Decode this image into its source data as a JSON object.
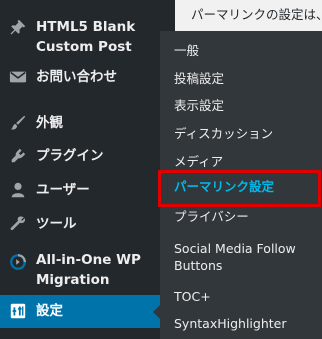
{
  "content": {
    "text": "パーマリンクの設定は、"
  },
  "menu": {
    "items": [
      {
        "id": "posttype",
        "label": "HTML5 Blank Custom Post",
        "icon": "pin-icon"
      },
      {
        "id": "contact",
        "label": "お問い合わせ",
        "icon": "mail-icon"
      },
      {
        "id": "appearance",
        "label": "外観",
        "icon": "paintbrush-icon"
      },
      {
        "id": "plugins",
        "label": "プラグイン",
        "icon": "plugin-icon"
      },
      {
        "id": "users",
        "label": "ユーザー",
        "icon": "user-icon"
      },
      {
        "id": "tools",
        "label": "ツール",
        "icon": "wrench-icon"
      },
      {
        "id": "aioseo",
        "label": "All-in-One WP Migration",
        "icon": "migration-icon"
      },
      {
        "id": "settings",
        "label": "設定",
        "icon": "settings-icon",
        "current": true
      }
    ]
  },
  "submenu": {
    "items": [
      {
        "label": "一般"
      },
      {
        "label": "投稿設定"
      },
      {
        "label": "表示設定"
      },
      {
        "label": "ディスカッション"
      },
      {
        "label": "メディア"
      },
      {
        "label": "パーマリンク設定",
        "active": true
      },
      {
        "label": "プライバシー"
      },
      {
        "label": "Social Media Follow Buttons"
      },
      {
        "label": "TOC+"
      },
      {
        "label": "SyntaxHighlighter"
      }
    ]
  },
  "colors": {
    "menu_bg": "#23282d",
    "submenu_bg": "#32373c",
    "current_bg": "#0073aa",
    "active_text": "#00b9eb",
    "highlight_box": "#e00000",
    "icon": "#a0a5aa"
  }
}
